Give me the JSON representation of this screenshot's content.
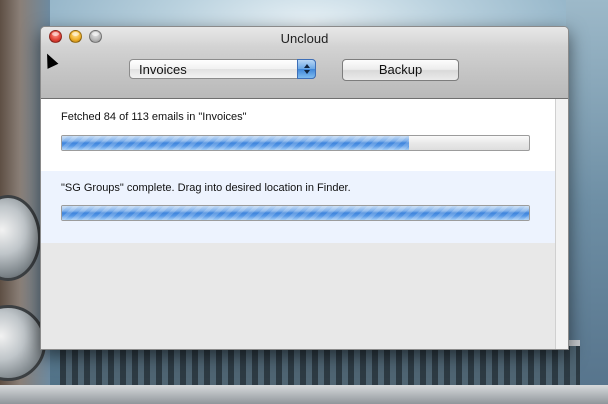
{
  "window": {
    "title": "Uncloud"
  },
  "toolbar": {
    "mailbox_popup_value": "Invoices",
    "backup_label": "Backup"
  },
  "tasks": [
    {
      "status": "Fetched 84 of 113 emails in \"Invoices\"",
      "progress": 0.743
    },
    {
      "status": "\"SG Groups\" complete. Drag into desired location in Finder.",
      "progress": 1.0
    }
  ],
  "icons": {
    "close": "close-icon",
    "minimize": "minimize-icon",
    "zoom": "zoom-icon",
    "popup_arrows": "updown-chevron-icon",
    "cursor": "mouse-pointer-icon"
  },
  "colors": {
    "progress_blue": "#3f85dc",
    "selected_row": "#edf3fe"
  }
}
